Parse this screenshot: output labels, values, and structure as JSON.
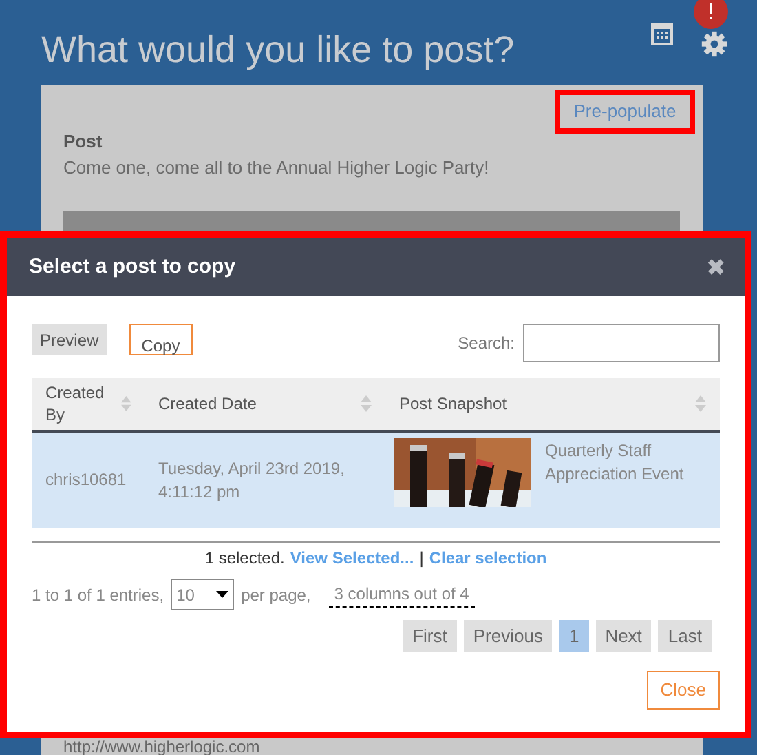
{
  "page": {
    "title": "What would you like to post?",
    "alert_badge": "!"
  },
  "composer": {
    "prepopulate_link": "Pre-populate",
    "post_label": "Post",
    "post_text": "Come one, come all to the Annual Higher Logic Party!",
    "link_text": "http://www.higherlogic.com"
  },
  "dialog": {
    "title": "Select a post to copy",
    "close_icon": "✖",
    "buttons": [
      {
        "label": "Preview",
        "kind": "plain"
      },
      {
        "label": "Copy",
        "kind": "outlined"
      }
    ],
    "search": {
      "label": "Search:"
    },
    "table": {
      "columns": [
        {
          "label": "Created By"
        },
        {
          "label": "Created Date"
        },
        {
          "label": "Post Snapshot"
        }
      ],
      "rows": [
        {
          "selected": true,
          "cells": [
            "chris10681",
            "Tuesday, April 23rd 2019, 4:11:12 pm"
          ],
          "snapshot": {
            "kind": "picture",
            "caption": "Quarterly Staff Appreciation Event"
          }
        }
      ]
    },
    "selection": {
      "count_text": "1 selected.",
      "view_link": "View Selected...",
      "separator": "|",
      "clear_link": "Clear selection"
    },
    "paging": {
      "entries_text": "1 to 1 of 1 entries,",
      "per_page_value": "10",
      "per_page_text": "per page,",
      "columns_link": "3 columns out of 4"
    },
    "pager": [
      {
        "label": "First",
        "selected": false
      },
      {
        "label": "Previous",
        "selected": false
      },
      {
        "label": "1",
        "selected": true
      },
      {
        "label": "Next",
        "selected": false
      },
      {
        "label": "Last",
        "selected": false
      }
    ],
    "footer_button": "Close"
  }
}
